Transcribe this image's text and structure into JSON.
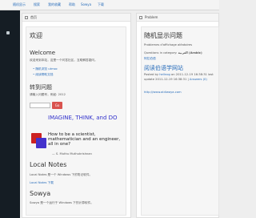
{
  "topnav": {
    "items": [
      "随机显示",
      "搜索",
      "我的收藏",
      "帮助",
      "Sowya",
      "下载"
    ]
  },
  "left_column": {
    "header": "首页",
    "welcome_cn": "欢迎",
    "welcome_en": "Welcome",
    "intro": "欢迎来到本站，这是一个问答社区，互助解答疑问。",
    "links": [
      "随机浏览 utmoc",
      "阅读帮助文档"
    ],
    "goto_title": "转到问题",
    "goto_desc": "请输入问题号，例如: 2012",
    "go_button": "Go",
    "quote_title": "IMAGINE, THINK, and DO",
    "quote_text": "How to be a scientist, mathematician and an engineer, all in one?",
    "quote_author": "— S. Muthu Muthukrishnan",
    "local_notes_title": "Local Notes",
    "local_notes_desc": "Local Notes 是一个 Windows 下的笔记软件。",
    "local_notes_link": "Local Notes 下载",
    "sowya_title": "Sowya",
    "sowya_desc": "Sowya 是一个运行于 Windows 下的计算软件。"
  },
  "right_column": {
    "header": "Problem",
    "title": "随机显示问题",
    "subtitle": "Problemes d'affichage aléatoires",
    "category_label": "Questions in category: ",
    "category_name": "العربية (Arabic)",
    "link_tag": "阿拉伯语",
    "question_title": "阅读伯语学网站",
    "posted_by": "Posted by ",
    "author": "hellnog",
    "posted_on": " on 2011-12-19 16:38:31 last update 2011-12-19 16:38:31 | ",
    "answers": "Answers (0)",
    "url": "http://www.aldiwaya.com"
  }
}
